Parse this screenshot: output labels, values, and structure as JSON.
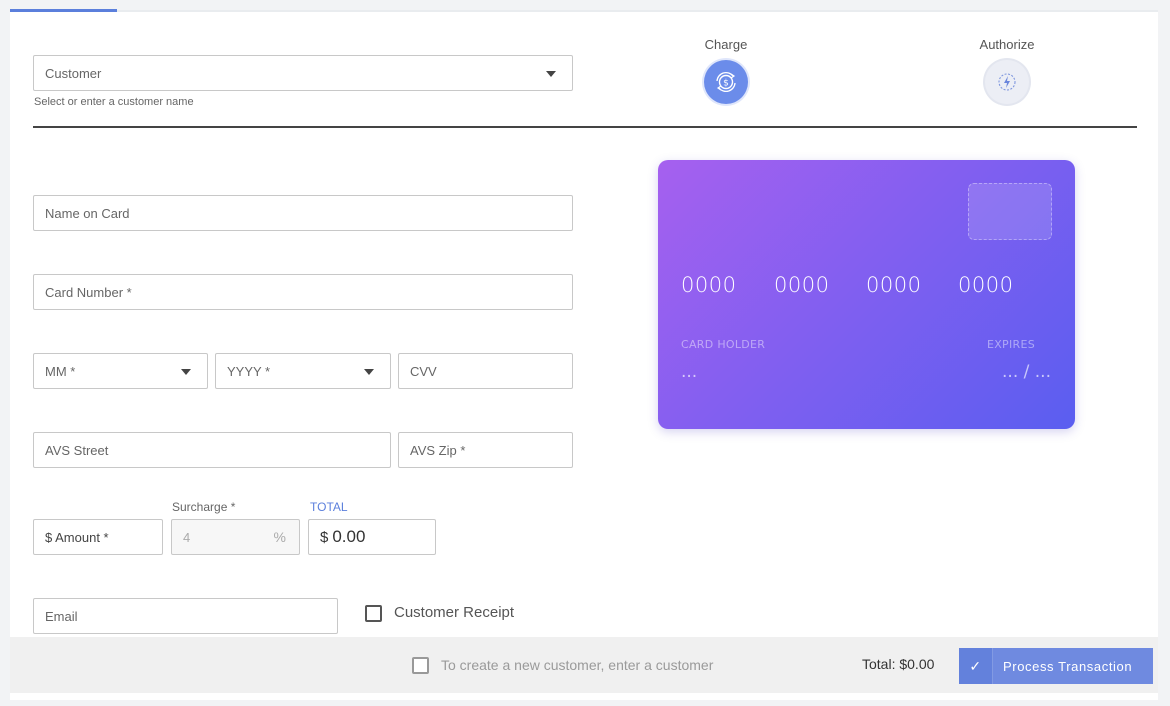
{
  "customer": {
    "placeholder": "Customer",
    "hint": "Select or enter a customer name"
  },
  "modes": {
    "charge": {
      "label": "Charge",
      "icon": "dollar-refresh-icon",
      "active": true
    },
    "authorize": {
      "label": "Authorize",
      "icon": "lightning-icon",
      "active": false
    }
  },
  "form": {
    "name_on_card": "Name on Card",
    "card_number": "Card Number *",
    "month": "MM *",
    "year": "YYYY *",
    "cvv": "CVV",
    "avs_street": "AVS Street",
    "avs_zip": "AVS Zip *",
    "amount": "$ Amount *",
    "surcharge_label": "Surcharge *",
    "surcharge_value": "4",
    "surcharge_unit": "%",
    "total_label": "TOTAL",
    "total_currency": "$",
    "total_value": "0.00",
    "email": "Email",
    "customer_receipt": "Customer Receipt"
  },
  "card_preview": {
    "groups": [
      "0000",
      "0000",
      "0000",
      "0000"
    ],
    "holder_label": "CARD HOLDER",
    "holder_value": "...",
    "expires_label": "EXPIRES",
    "expires_value": "... / ..."
  },
  "footer": {
    "create_customer": "To create a new customer, enter a customer",
    "total": "Total: $0.00",
    "process_label": "Process Transaction"
  },
  "colors": {
    "accent": "#5b7fdc",
    "card_gradient": [
      "#a660ef",
      "#5a5ef0"
    ]
  }
}
